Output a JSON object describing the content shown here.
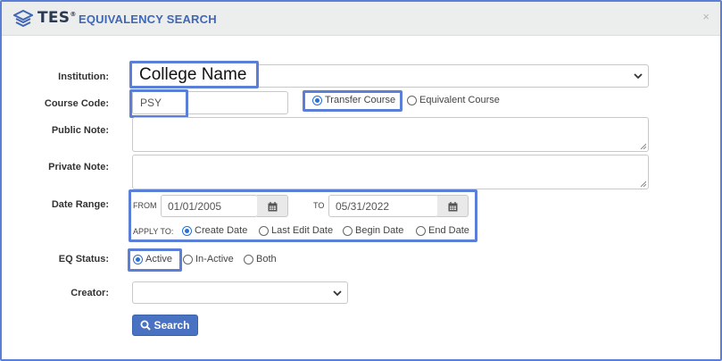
{
  "header": {
    "logo_text": "TES",
    "logo_mark": "®",
    "title": "EQUIVALENCY SEARCH",
    "close_symbol": "×"
  },
  "form": {
    "institution": {
      "label": "Institution:",
      "selected": "College Name"
    },
    "course_code": {
      "label": "Course Code:",
      "value": "PSY",
      "options": [
        {
          "label": "Transfer Course",
          "checked": true
        },
        {
          "label": "Equivalent Course",
          "checked": false
        }
      ]
    },
    "public_note": {
      "label": "Public Note:",
      "value": ""
    },
    "private_note": {
      "label": "Private Note:",
      "value": ""
    },
    "date_range": {
      "label": "Date Range:",
      "from_label": "FROM",
      "from_value": "01/01/2005",
      "to_label": "TO",
      "to_value": "05/31/2022",
      "apply_to_label": "APPLY TO:",
      "apply_to": [
        {
          "label": "Create Date",
          "checked": true
        },
        {
          "label": "Last Edit Date",
          "checked": false
        },
        {
          "label": "Begin Date",
          "checked": false
        },
        {
          "label": "End Date",
          "checked": false
        }
      ]
    },
    "eq_status": {
      "label": "EQ Status:",
      "options": [
        {
          "label": "Active",
          "checked": true
        },
        {
          "label": "In-Active",
          "checked": false
        },
        {
          "label": "Both",
          "checked": false
        }
      ]
    },
    "creator": {
      "label": "Creator:",
      "selected": ""
    },
    "search_button": "Search"
  },
  "colors": {
    "accent": "#5b7fd6",
    "button": "#4a72c2",
    "title": "#3f67b5"
  }
}
